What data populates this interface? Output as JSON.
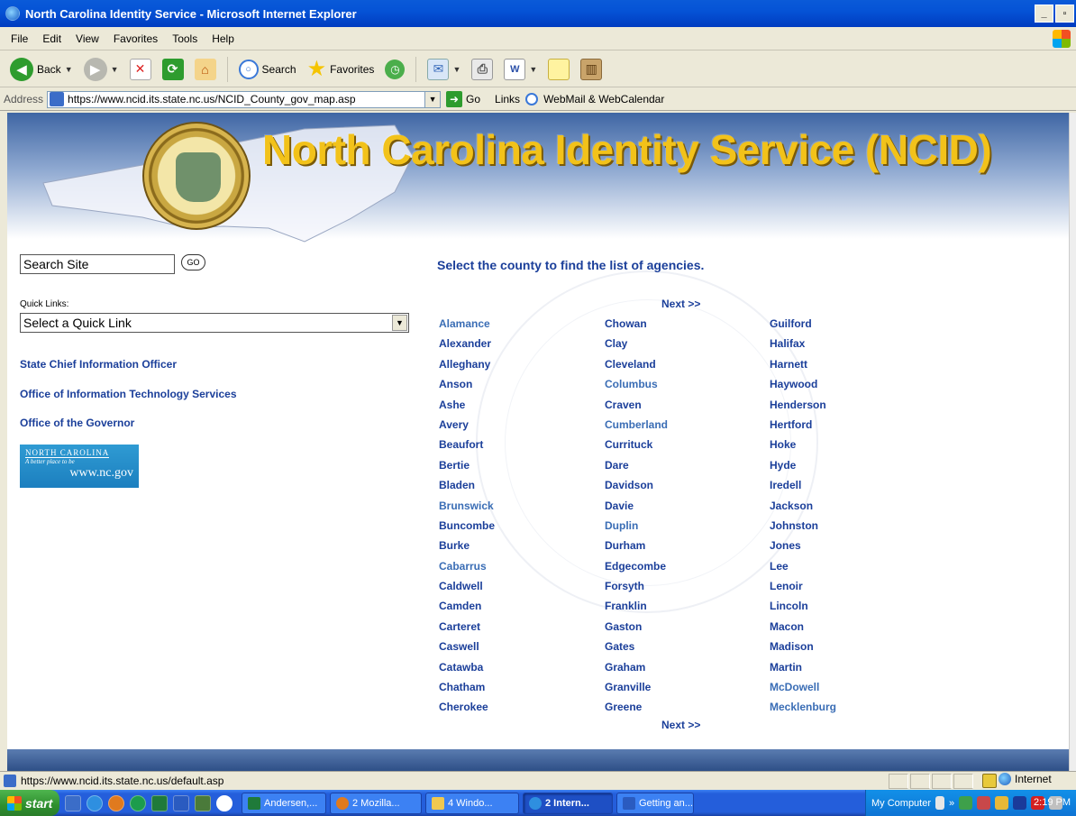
{
  "window": {
    "title": "North Carolina Identity Service - Microsoft Internet Explorer",
    "min": "_",
    "max": "▫",
    "close": "✕"
  },
  "menu": [
    "File",
    "Edit",
    "View",
    "Favorites",
    "Tools",
    "Help"
  ],
  "toolbar": {
    "back_label": "Back",
    "search_label": "Search",
    "favorites_label": "Favorites"
  },
  "address": {
    "label": "Address",
    "url": "https://www.ncid.its.state.nc.us/NCID_County_gov_map.asp",
    "go_label": "Go",
    "links_label": "Links",
    "webmail_label": "WebMail & WebCalendar"
  },
  "page": {
    "banner_title": "North Carolina Identity Service (NCID)",
    "search_placeholder": "Search Site",
    "search_go": "GO",
    "quicklinks_label": "Quick Links:",
    "quicklinks_selected": "Select a Quick Link",
    "left_links": [
      "State Chief Information Officer",
      "Office of Information Technology Services",
      "Office of the Governor"
    ],
    "ncgov": {
      "line1": "North Carolina",
      "line2": "A better place to be",
      "line3": "www.nc.gov"
    },
    "instructions": "Select the county to find the list of agencies.",
    "next_label": "Next >>",
    "counties": {
      "col1": [
        "Alamance",
        "Alexander",
        "Alleghany",
        "Anson",
        "Ashe",
        "Avery",
        "Beaufort",
        "Bertie",
        "Bladen",
        "Brunswick",
        "Buncombe",
        "Burke",
        "Cabarrus",
        "Caldwell",
        "Camden",
        "Carteret",
        "Caswell",
        "Catawba",
        "Chatham",
        "Cherokee"
      ],
      "col2": [
        "Chowan",
        "Clay",
        "Cleveland",
        "Columbus",
        "Craven",
        "Cumberland",
        "Currituck",
        "Dare",
        "Davidson",
        "Davie",
        "Duplin",
        "Durham",
        "Edgecombe",
        "Forsyth",
        "Franklin",
        "Gaston",
        "Gates",
        "Graham",
        "Granville",
        "Greene"
      ],
      "col3": [
        "Guilford",
        "Halifax",
        "Harnett",
        "Haywood",
        "Henderson",
        "Hertford",
        "Hoke",
        "Hyde",
        "Iredell",
        "Jackson",
        "Johnston",
        "Jones",
        "Lee",
        "Lenoir",
        "Lincoln",
        "Macon",
        "Madison",
        "Martin",
        "McDowell",
        "Mecklenburg"
      ]
    },
    "visited_counties": [
      "Alamance",
      "Brunswick",
      "Cabarrus",
      "Columbus",
      "Cumberland",
      "Duplin",
      "McDowell",
      "Mecklenburg"
    ]
  },
  "status": {
    "url": "https://www.ncid.its.state.nc.us/default.asp",
    "zone": "Internet"
  },
  "taskbar": {
    "start_label": "start",
    "tasks": [
      "Andersen,...",
      "2 Mozilla...",
      "4 Windo...",
      "2 Intern...",
      "Getting an..."
    ],
    "active_task": 3,
    "tray_label": "My Computer",
    "chevron": "»",
    "clock": "2:19 PM"
  },
  "colors": {
    "link": "#1b3f9a",
    "visited_link": "#3a6db5",
    "banner_title": "#f2c21a"
  }
}
